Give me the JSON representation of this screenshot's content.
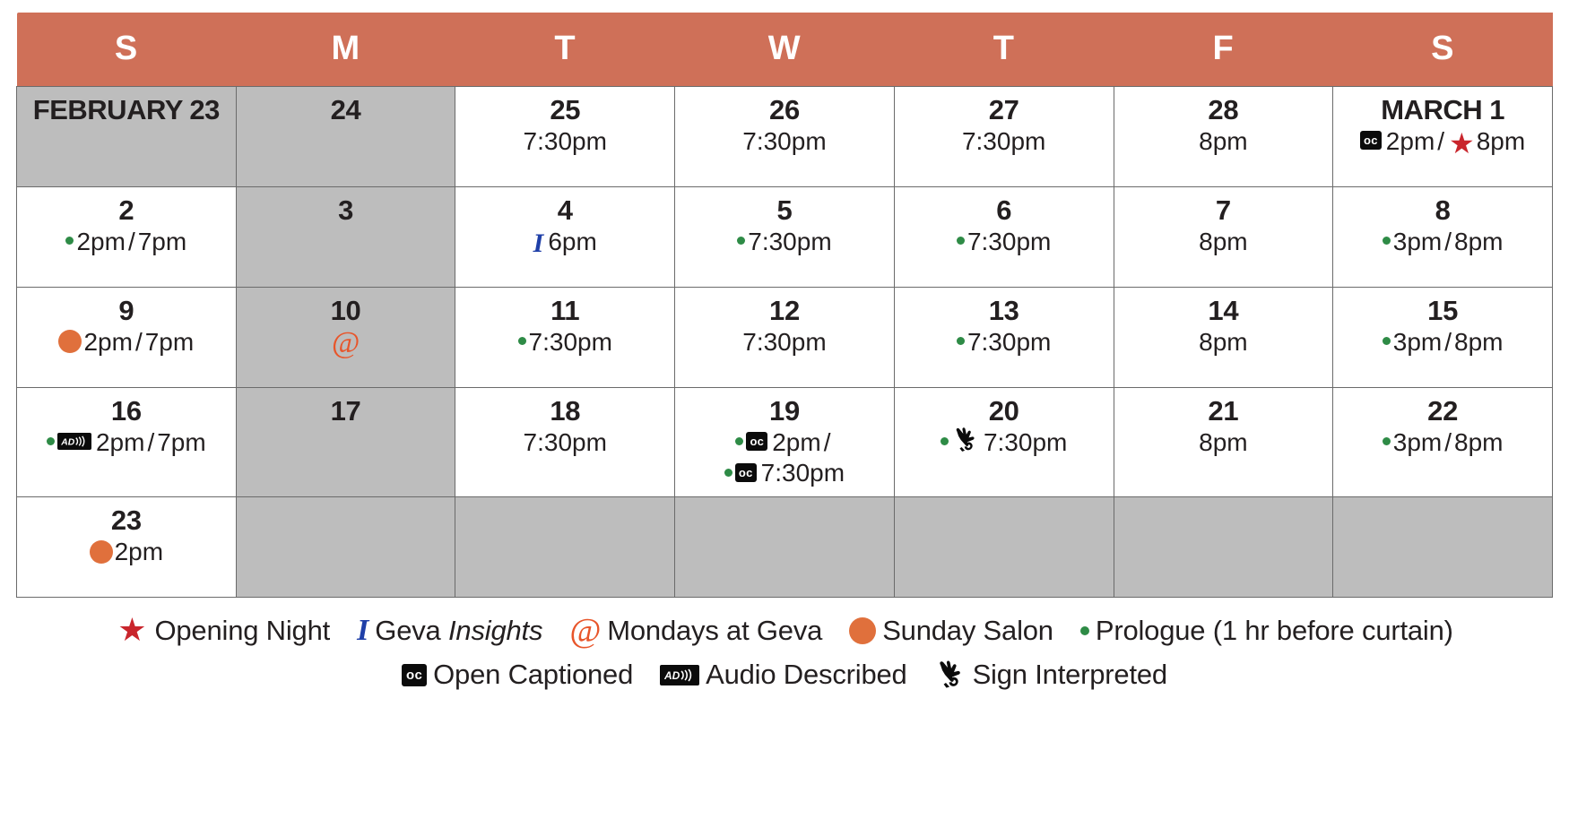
{
  "colors": {
    "header_bg": "#cf7058",
    "off_day_bg": "#bdbdbd",
    "grid_line": "#6b6b6b",
    "opening_night": "#c9252c",
    "insights": "#1f3fa8",
    "mondays": "#e8552a",
    "sunday_salon": "#e0703c",
    "prologue": "#2e8b46",
    "text": "#231f20"
  },
  "weekday_headers": [
    "S",
    "M",
    "T",
    "W",
    "T",
    "F",
    "S"
  ],
  "weeks": [
    [
      {
        "daynum": "FEBRUARY 23",
        "state": "off",
        "is_month": true,
        "lines": []
      },
      {
        "daynum": "24",
        "state": "off",
        "lines": []
      },
      {
        "daynum": "25",
        "state": "show",
        "lines": [
          {
            "parts": [
              {
                "type": "text",
                "text": "7:30pm"
              }
            ]
          }
        ]
      },
      {
        "daynum": "26",
        "state": "show",
        "lines": [
          {
            "parts": [
              {
                "type": "text",
                "text": "7:30pm"
              }
            ]
          }
        ]
      },
      {
        "daynum": "27",
        "state": "show",
        "lines": [
          {
            "parts": [
              {
                "type": "text",
                "text": "7:30pm"
              }
            ]
          }
        ]
      },
      {
        "daynum": "28",
        "state": "show",
        "lines": [
          {
            "parts": [
              {
                "type": "text",
                "text": "8pm"
              }
            ]
          }
        ]
      },
      {
        "daynum": "MARCH 1",
        "state": "show",
        "is_month": true,
        "lines": [
          {
            "parts": [
              {
                "type": "icon",
                "icon": "open-captioned"
              },
              {
                "type": "text",
                "text": "2pm"
              },
              {
                "type": "slash",
                "text": "/"
              },
              {
                "type": "icon",
                "icon": "opening-night"
              },
              {
                "type": "text",
                "text": "8pm"
              }
            ]
          }
        ]
      }
    ],
    [
      {
        "daynum": "2",
        "state": "show",
        "lines": [
          {
            "parts": [
              {
                "type": "icon",
                "icon": "prologue"
              },
              {
                "type": "text",
                "text": "2pm"
              },
              {
                "type": "slash",
                "text": "/"
              },
              {
                "type": "text",
                "text": "7pm"
              }
            ]
          }
        ]
      },
      {
        "daynum": "3",
        "state": "off",
        "lines": []
      },
      {
        "daynum": "4",
        "state": "show",
        "lines": [
          {
            "parts": [
              {
                "type": "icon",
                "icon": "insights"
              },
              {
                "type": "text",
                "text": "6pm"
              }
            ]
          }
        ]
      },
      {
        "daynum": "5",
        "state": "show",
        "lines": [
          {
            "parts": [
              {
                "type": "icon",
                "icon": "prologue"
              },
              {
                "type": "text",
                "text": "7:30pm"
              }
            ]
          }
        ]
      },
      {
        "daynum": "6",
        "state": "show",
        "lines": [
          {
            "parts": [
              {
                "type": "icon",
                "icon": "prologue"
              },
              {
                "type": "text",
                "text": "7:30pm"
              }
            ]
          }
        ]
      },
      {
        "daynum": "7",
        "state": "show",
        "lines": [
          {
            "parts": [
              {
                "type": "text",
                "text": "8pm"
              }
            ]
          }
        ]
      },
      {
        "daynum": "8",
        "state": "show",
        "lines": [
          {
            "parts": [
              {
                "type": "icon",
                "icon": "prologue"
              },
              {
                "type": "text",
                "text": "3pm"
              },
              {
                "type": "slash",
                "text": "/"
              },
              {
                "type": "text",
                "text": "8pm"
              }
            ]
          }
        ]
      }
    ],
    [
      {
        "daynum": "9",
        "state": "show",
        "lines": [
          {
            "parts": [
              {
                "type": "icon",
                "icon": "sunday-salon"
              },
              {
                "type": "text",
                "text": "2pm"
              },
              {
                "type": "slash",
                "text": "/"
              },
              {
                "type": "text",
                "text": "7pm"
              }
            ]
          }
        ]
      },
      {
        "daynum": "10",
        "state": "off",
        "lines": [
          {
            "parts": [
              {
                "type": "icon",
                "icon": "mondays-at-geva"
              }
            ]
          }
        ]
      },
      {
        "daynum": "11",
        "state": "show",
        "lines": [
          {
            "parts": [
              {
                "type": "icon",
                "icon": "prologue"
              },
              {
                "type": "text",
                "text": "7:30pm"
              }
            ]
          }
        ]
      },
      {
        "daynum": "12",
        "state": "show",
        "lines": [
          {
            "parts": [
              {
                "type": "text",
                "text": "7:30pm"
              }
            ]
          }
        ]
      },
      {
        "daynum": "13",
        "state": "show",
        "lines": [
          {
            "parts": [
              {
                "type": "icon",
                "icon": "prologue"
              },
              {
                "type": "text",
                "text": "7:30pm"
              }
            ]
          }
        ]
      },
      {
        "daynum": "14",
        "state": "show",
        "lines": [
          {
            "parts": [
              {
                "type": "text",
                "text": "8pm"
              }
            ]
          }
        ]
      },
      {
        "daynum": "15",
        "state": "show",
        "lines": [
          {
            "parts": [
              {
                "type": "icon",
                "icon": "prologue"
              },
              {
                "type": "text",
                "text": "3pm"
              },
              {
                "type": "slash",
                "text": "/"
              },
              {
                "type": "text",
                "text": "8pm"
              }
            ]
          }
        ]
      }
    ],
    [
      {
        "daynum": "16",
        "state": "show",
        "wrap": true,
        "lines": [
          {
            "parts": [
              {
                "type": "icon",
                "icon": "prologue"
              },
              {
                "type": "icon",
                "icon": "audio-described"
              },
              {
                "type": "text",
                "text": "2pm"
              },
              {
                "type": "slash",
                "text": "/"
              },
              {
                "type": "text",
                "text": "7pm"
              }
            ]
          }
        ]
      },
      {
        "daynum": "17",
        "state": "off",
        "lines": []
      },
      {
        "daynum": "18",
        "state": "show",
        "lines": [
          {
            "parts": [
              {
                "type": "text",
                "text": "7:30pm"
              }
            ]
          }
        ]
      },
      {
        "daynum": "19",
        "state": "show",
        "lines": [
          {
            "parts": [
              {
                "type": "icon",
                "icon": "prologue"
              },
              {
                "type": "icon",
                "icon": "open-captioned"
              },
              {
                "type": "text",
                "text": "2pm"
              },
              {
                "type": "slash",
                "text": "/"
              }
            ]
          },
          {
            "parts": [
              {
                "type": "icon",
                "icon": "prologue"
              },
              {
                "type": "icon",
                "icon": "open-captioned"
              },
              {
                "type": "text",
                "text": "7:30pm"
              }
            ]
          }
        ]
      },
      {
        "daynum": "20",
        "state": "show",
        "lines": [
          {
            "parts": [
              {
                "type": "icon",
                "icon": "prologue"
              },
              {
                "type": "icon",
                "icon": "sign-interpreted"
              },
              {
                "type": "text",
                "text": "7:30pm"
              }
            ]
          }
        ]
      },
      {
        "daynum": "21",
        "state": "show",
        "lines": [
          {
            "parts": [
              {
                "type": "text",
                "text": "8pm"
              }
            ]
          }
        ]
      },
      {
        "daynum": "22",
        "state": "show",
        "lines": [
          {
            "parts": [
              {
                "type": "icon",
                "icon": "prologue"
              },
              {
                "type": "text",
                "text": "3pm"
              },
              {
                "type": "slash",
                "text": "/"
              },
              {
                "type": "text",
                "text": "8pm"
              }
            ]
          }
        ]
      }
    ],
    [
      {
        "daynum": "23",
        "state": "show",
        "lines": [
          {
            "parts": [
              {
                "type": "icon",
                "icon": "sunday-salon"
              },
              {
                "type": "text",
                "text": "2pm"
              }
            ]
          }
        ]
      },
      {
        "daynum": "",
        "state": "off",
        "lines": []
      },
      {
        "daynum": "",
        "state": "off",
        "lines": []
      },
      {
        "daynum": "",
        "state": "off",
        "lines": []
      },
      {
        "daynum": "",
        "state": "off",
        "lines": []
      },
      {
        "daynum": "",
        "state": "off",
        "lines": []
      },
      {
        "daynum": "",
        "state": "off",
        "lines": []
      }
    ]
  ],
  "legend": {
    "row1": [
      {
        "icon": "opening-night",
        "label": "Opening Night"
      },
      {
        "icon": "insights",
        "label": "Geva ",
        "label_em": "Insights"
      },
      {
        "icon": "mondays-at-geva",
        "label": "Mondays at Geva"
      },
      {
        "icon": "sunday-salon",
        "label": "Sunday Salon"
      },
      {
        "icon": "prologue",
        "label": "Prologue (1 hr before curtain)"
      }
    ],
    "row2": [
      {
        "icon": "open-captioned",
        "label": "Open Captioned"
      },
      {
        "icon": "audio-described",
        "label": "Audio Described"
      },
      {
        "icon": "sign-interpreted",
        "label": "Sign Interpreted"
      }
    ]
  },
  "icon_labels": {
    "opening-night": "star-icon",
    "insights": "insights-i-icon",
    "mondays-at-geva": "at-symbol-icon",
    "sunday-salon": "orange-circle-icon",
    "prologue": "green-dot-icon",
    "open-captioned": "open-captioned-icon",
    "audio-described": "audio-described-icon",
    "sign-interpreted": "sign-interpreted-icon"
  }
}
